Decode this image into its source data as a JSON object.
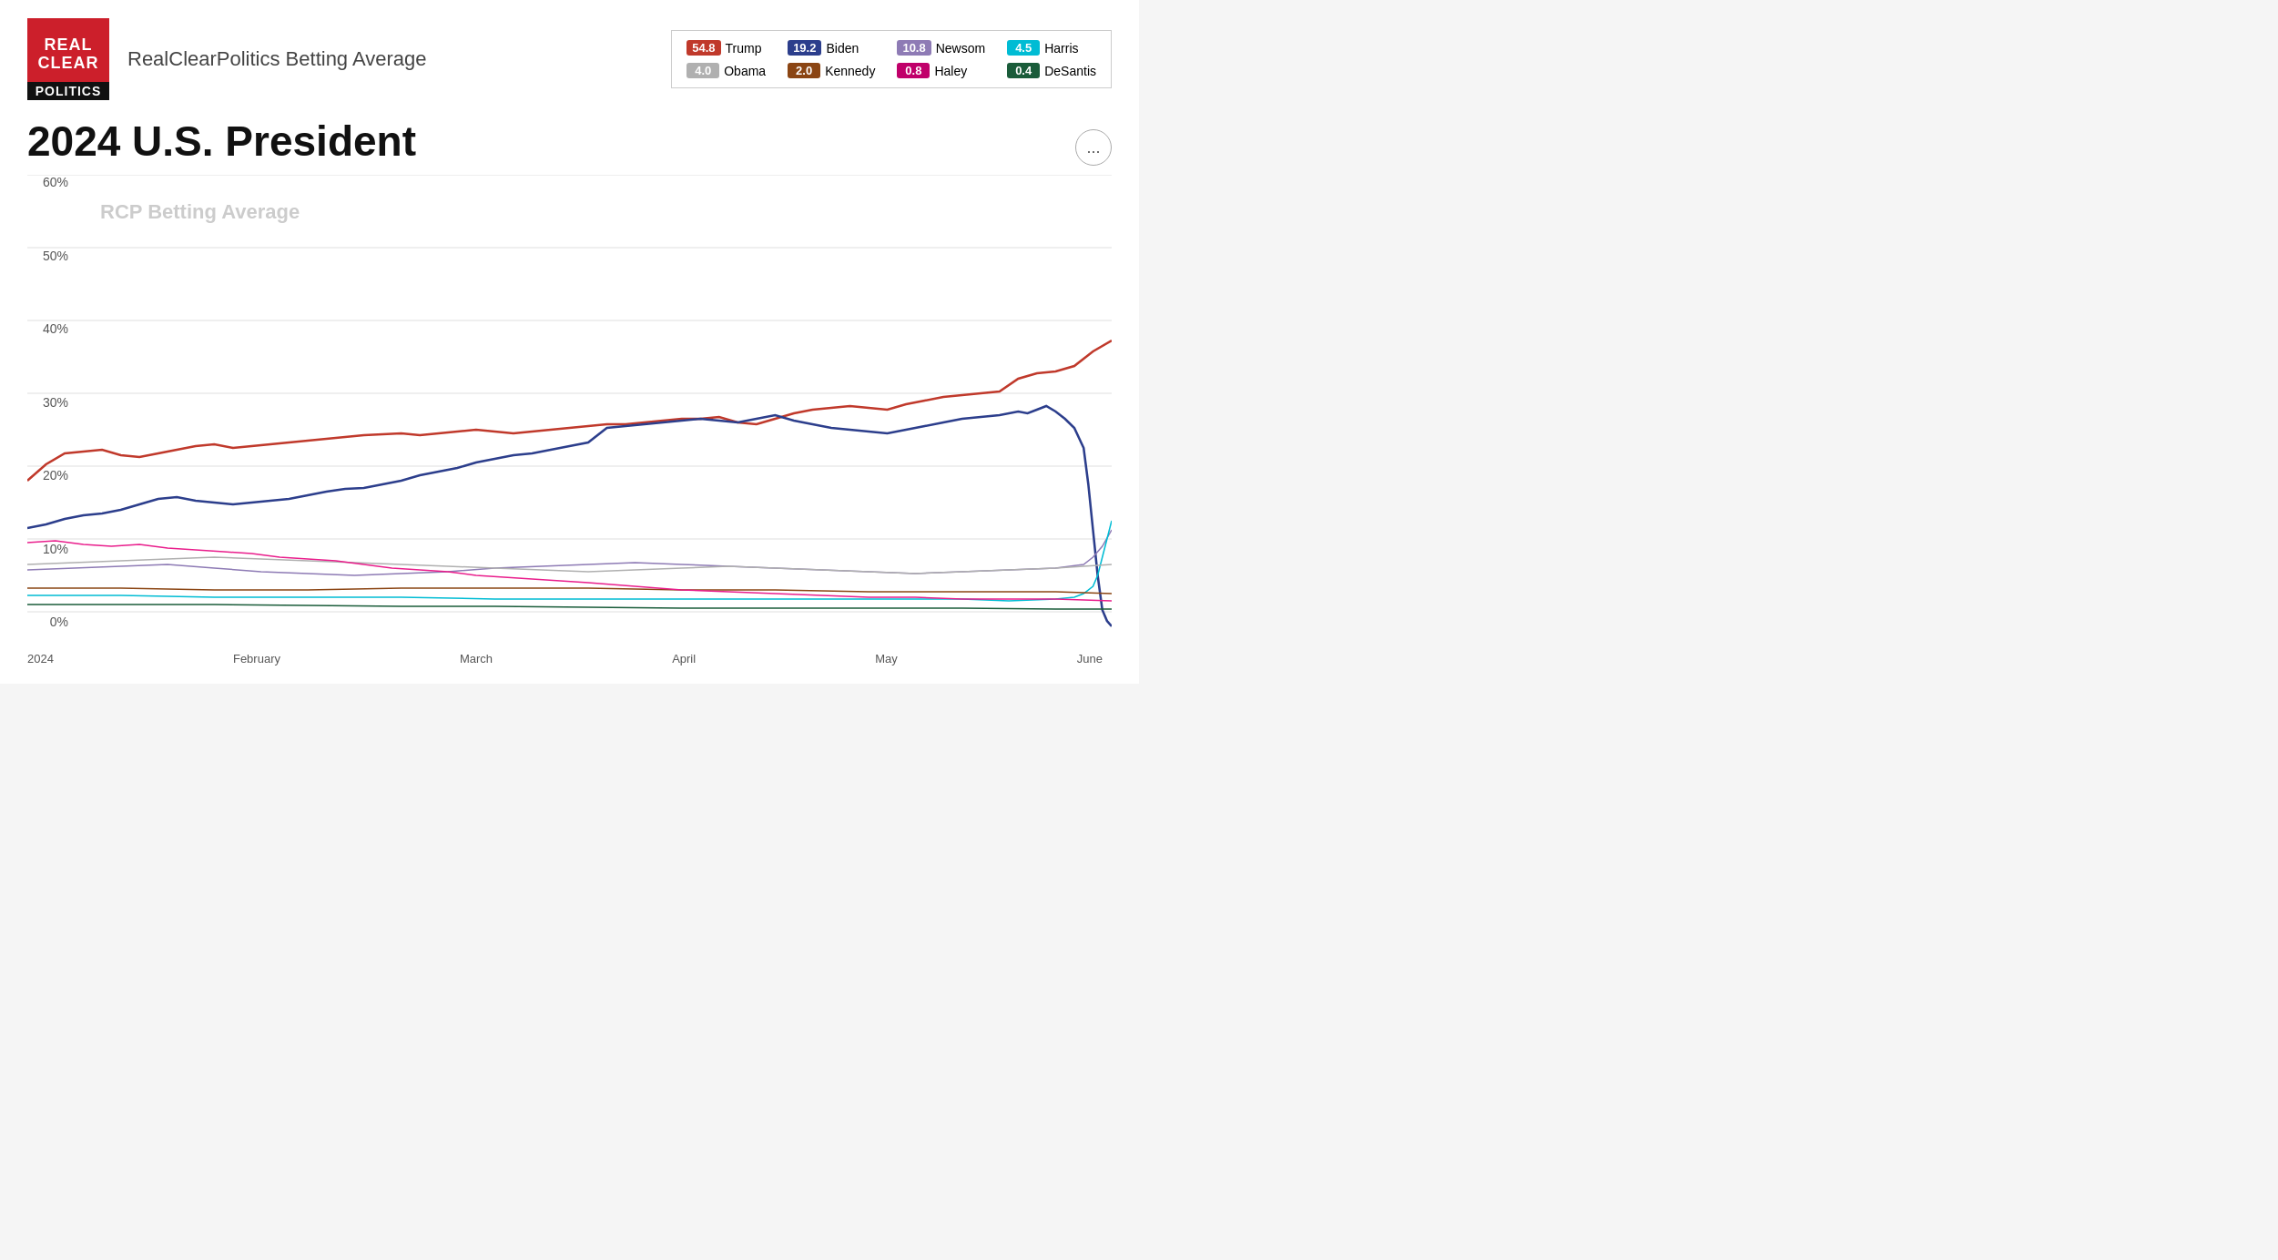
{
  "header": {
    "logo_line1": "REAL",
    "logo_line2": "CLEAR",
    "logo_line3": "POLITICS",
    "subtitle": "RealClearPolitics Betting Average"
  },
  "legend": {
    "items": [
      {
        "label": "Trump",
        "value": "54.8",
        "color": "#c0392b",
        "text_color": "#fff"
      },
      {
        "label": "Biden",
        "value": "19.2",
        "color": "#2c3e8c",
        "text_color": "#fff"
      },
      {
        "label": "Newsom",
        "value": "10.8",
        "color": "#8e7bb5",
        "text_color": "#fff"
      },
      {
        "label": "Harris",
        "value": "4.5",
        "color": "#00bcd4",
        "text_color": "#fff"
      },
      {
        "label": "Obama",
        "value": "4.0",
        "color": "#b0b0b0",
        "text_color": "#fff"
      },
      {
        "label": "Kennedy",
        "value": "2.0",
        "color": "#8b4513",
        "text_color": "#fff"
      },
      {
        "label": "Haley",
        "value": "0.8",
        "color": "#c0006a",
        "text_color": "#fff"
      },
      {
        "label": "DeSantis",
        "value": "0.4",
        "color": "#1a5c3a",
        "text_color": "#fff"
      }
    ]
  },
  "page_title": "2024 U.S. President",
  "chart": {
    "watermark": "RCP Betting Average",
    "y_labels": [
      "60%",
      "50%",
      "40%",
      "30%",
      "20%",
      "10%",
      "0%"
    ],
    "x_labels": [
      "2024",
      "February",
      "March",
      "April",
      "May",
      "June"
    ],
    "more_button": "..."
  }
}
